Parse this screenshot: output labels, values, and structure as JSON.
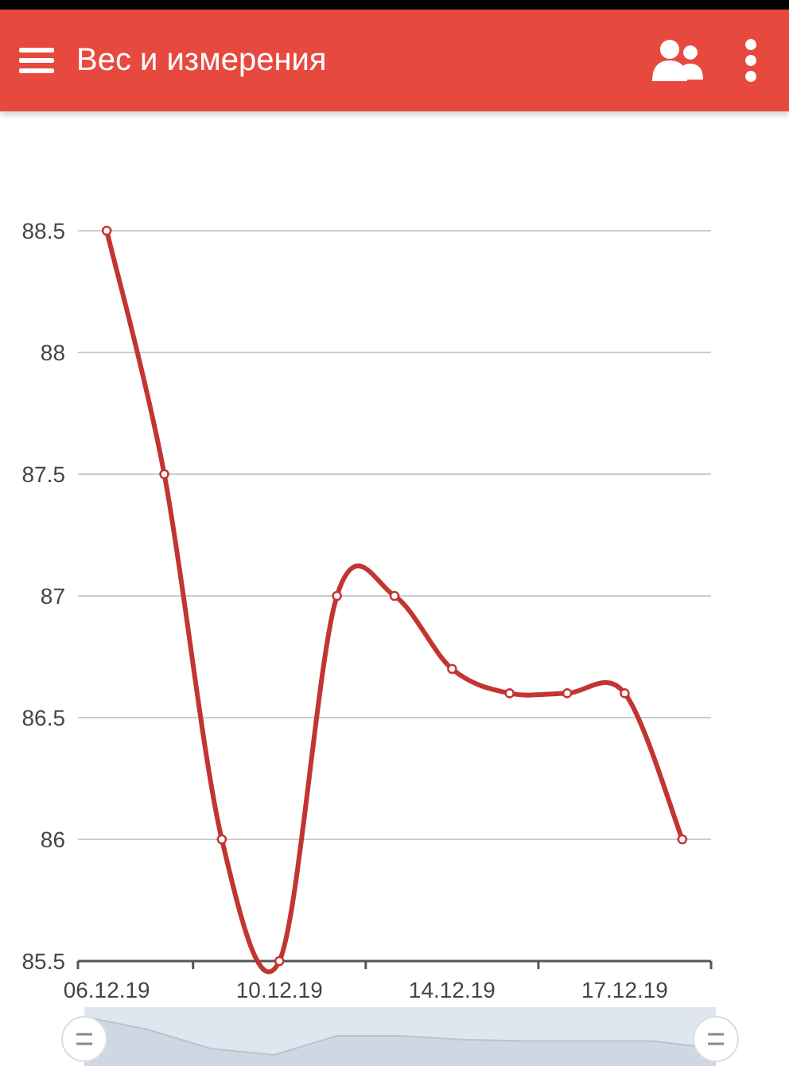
{
  "app_bar": {
    "title": "Вес и измерения"
  },
  "chart": {
    "chart_data": {
      "type": "line",
      "grid": true,
      "categories": [
        "06.12.19",
        null,
        null,
        "10.12.19",
        null,
        null,
        "14.12.19",
        null,
        null,
        "17.12.19",
        null
      ],
      "ylim": [
        85.5,
        88.5
      ],
      "yticks": [
        85.5,
        86,
        86.5,
        87,
        87.5,
        88,
        88.5
      ],
      "series": [
        {
          "color": "#c23531",
          "marker": true,
          "values": [
            88.5,
            87.5,
            86,
            85.5,
            87,
            87,
            86.7,
            86.6,
            86.6,
            86.6,
            86
          ]
        }
      ]
    }
  }
}
